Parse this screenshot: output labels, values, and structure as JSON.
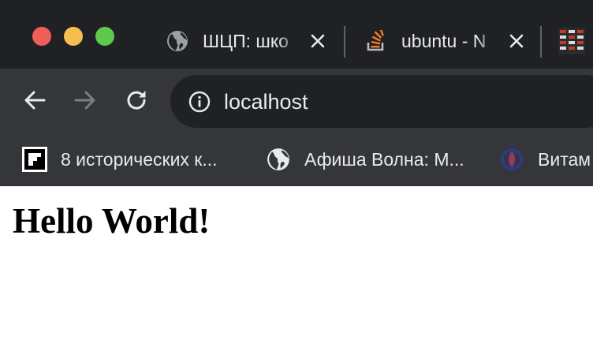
{
  "window": {
    "traffic_lights": [
      "close",
      "minimize",
      "zoom"
    ],
    "colors": {
      "close": "#ee5f57",
      "minimize": "#f5bf4f",
      "zoom": "#5ec94b"
    }
  },
  "tabs": [
    {
      "title": "ШЦП: шко",
      "favicon": "globe-icon"
    },
    {
      "title": "ubuntu - N",
      "favicon": "stackoverflow-icon"
    },
    {
      "title": "",
      "favicon": "app-icon"
    }
  ],
  "toolbar": {
    "back_icon": "back-arrow-icon",
    "forward_icon": "forward-arrow-icon",
    "reload_icon": "reload-icon",
    "address": "localhost",
    "address_icon": "info-icon"
  },
  "bookmarks": [
    {
      "label": "8 исторических к...",
      "icon": "flipboard-icon"
    },
    {
      "label": "Афиша Волна: М...",
      "icon": "globe-icon"
    },
    {
      "label": "Витам",
      "icon": "circle-logo-icon"
    }
  ],
  "page": {
    "heading": "Hello World!"
  }
}
